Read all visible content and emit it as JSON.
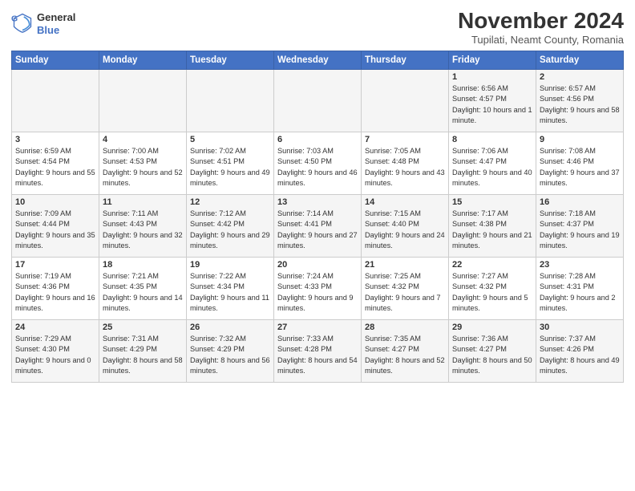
{
  "logo": {
    "line1": "General",
    "line2": "Blue"
  },
  "title": "November 2024",
  "location": "Tupilati, Neamt County, Romania",
  "headers": [
    "Sunday",
    "Monday",
    "Tuesday",
    "Wednesday",
    "Thursday",
    "Friday",
    "Saturday"
  ],
  "weeks": [
    [
      {
        "day": "",
        "info": ""
      },
      {
        "day": "",
        "info": ""
      },
      {
        "day": "",
        "info": ""
      },
      {
        "day": "",
        "info": ""
      },
      {
        "day": "",
        "info": ""
      },
      {
        "day": "1",
        "info": "Sunrise: 6:56 AM\nSunset: 4:57 PM\nDaylight: 10 hours and 1 minute."
      },
      {
        "day": "2",
        "info": "Sunrise: 6:57 AM\nSunset: 4:56 PM\nDaylight: 9 hours and 58 minutes."
      }
    ],
    [
      {
        "day": "3",
        "info": "Sunrise: 6:59 AM\nSunset: 4:54 PM\nDaylight: 9 hours and 55 minutes."
      },
      {
        "day": "4",
        "info": "Sunrise: 7:00 AM\nSunset: 4:53 PM\nDaylight: 9 hours and 52 minutes."
      },
      {
        "day": "5",
        "info": "Sunrise: 7:02 AM\nSunset: 4:51 PM\nDaylight: 9 hours and 49 minutes."
      },
      {
        "day": "6",
        "info": "Sunrise: 7:03 AM\nSunset: 4:50 PM\nDaylight: 9 hours and 46 minutes."
      },
      {
        "day": "7",
        "info": "Sunrise: 7:05 AM\nSunset: 4:48 PM\nDaylight: 9 hours and 43 minutes."
      },
      {
        "day": "8",
        "info": "Sunrise: 7:06 AM\nSunset: 4:47 PM\nDaylight: 9 hours and 40 minutes."
      },
      {
        "day": "9",
        "info": "Sunrise: 7:08 AM\nSunset: 4:46 PM\nDaylight: 9 hours and 37 minutes."
      }
    ],
    [
      {
        "day": "10",
        "info": "Sunrise: 7:09 AM\nSunset: 4:44 PM\nDaylight: 9 hours and 35 minutes."
      },
      {
        "day": "11",
        "info": "Sunrise: 7:11 AM\nSunset: 4:43 PM\nDaylight: 9 hours and 32 minutes."
      },
      {
        "day": "12",
        "info": "Sunrise: 7:12 AM\nSunset: 4:42 PM\nDaylight: 9 hours and 29 minutes."
      },
      {
        "day": "13",
        "info": "Sunrise: 7:14 AM\nSunset: 4:41 PM\nDaylight: 9 hours and 27 minutes."
      },
      {
        "day": "14",
        "info": "Sunrise: 7:15 AM\nSunset: 4:40 PM\nDaylight: 9 hours and 24 minutes."
      },
      {
        "day": "15",
        "info": "Sunrise: 7:17 AM\nSunset: 4:38 PM\nDaylight: 9 hours and 21 minutes."
      },
      {
        "day": "16",
        "info": "Sunrise: 7:18 AM\nSunset: 4:37 PM\nDaylight: 9 hours and 19 minutes."
      }
    ],
    [
      {
        "day": "17",
        "info": "Sunrise: 7:19 AM\nSunset: 4:36 PM\nDaylight: 9 hours and 16 minutes."
      },
      {
        "day": "18",
        "info": "Sunrise: 7:21 AM\nSunset: 4:35 PM\nDaylight: 9 hours and 14 minutes."
      },
      {
        "day": "19",
        "info": "Sunrise: 7:22 AM\nSunset: 4:34 PM\nDaylight: 9 hours and 11 minutes."
      },
      {
        "day": "20",
        "info": "Sunrise: 7:24 AM\nSunset: 4:33 PM\nDaylight: 9 hours and 9 minutes."
      },
      {
        "day": "21",
        "info": "Sunrise: 7:25 AM\nSunset: 4:32 PM\nDaylight: 9 hours and 7 minutes."
      },
      {
        "day": "22",
        "info": "Sunrise: 7:27 AM\nSunset: 4:32 PM\nDaylight: 9 hours and 5 minutes."
      },
      {
        "day": "23",
        "info": "Sunrise: 7:28 AM\nSunset: 4:31 PM\nDaylight: 9 hours and 2 minutes."
      }
    ],
    [
      {
        "day": "24",
        "info": "Sunrise: 7:29 AM\nSunset: 4:30 PM\nDaylight: 9 hours and 0 minutes."
      },
      {
        "day": "25",
        "info": "Sunrise: 7:31 AM\nSunset: 4:29 PM\nDaylight: 8 hours and 58 minutes."
      },
      {
        "day": "26",
        "info": "Sunrise: 7:32 AM\nSunset: 4:29 PM\nDaylight: 8 hours and 56 minutes."
      },
      {
        "day": "27",
        "info": "Sunrise: 7:33 AM\nSunset: 4:28 PM\nDaylight: 8 hours and 54 minutes."
      },
      {
        "day": "28",
        "info": "Sunrise: 7:35 AM\nSunset: 4:27 PM\nDaylight: 8 hours and 52 minutes."
      },
      {
        "day": "29",
        "info": "Sunrise: 7:36 AM\nSunset: 4:27 PM\nDaylight: 8 hours and 50 minutes."
      },
      {
        "day": "30",
        "info": "Sunrise: 7:37 AM\nSunset: 4:26 PM\nDaylight: 8 hours and 49 minutes."
      }
    ]
  ]
}
